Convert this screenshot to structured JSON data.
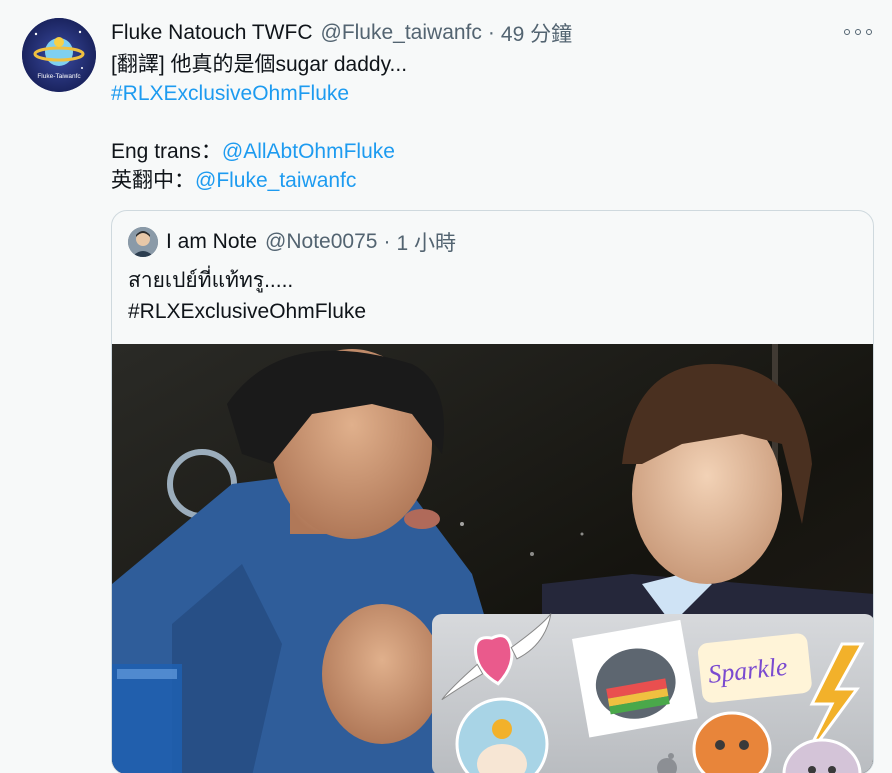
{
  "tweet": {
    "display_name": "Fluke Natouch TWFC",
    "handle": "@Fluke_taiwanfc",
    "separator": "·",
    "time": "49 分鐘",
    "avatar_caption": "Fluke-Taiwanfc",
    "lines": {
      "line1": "[翻譯] 他真的是個sugar daddy...",
      "hashtag": "#RLXExclusiveOhmFluke",
      "eng_prefix": "Eng trans：",
      "eng_mention": "@AllAbtOhmFluke",
      "zh_prefix": "英翻中：",
      "zh_mention": "@Fluke_taiwanfc"
    }
  },
  "quoted": {
    "display_name": "I am Note",
    "handle": "@Note0075",
    "separator": "·",
    "time": "1 小時",
    "text_line1": "สายเปย์ที่แท้ทรู.....",
    "text_line2": "#RLXExclusiveOhmFluke",
    "sticker_text": "Sparkle"
  },
  "colors": {
    "link": "#1d9bf0",
    "background": "#f7f9f9",
    "secondary_text": "#536471",
    "border": "#cfd9de"
  }
}
